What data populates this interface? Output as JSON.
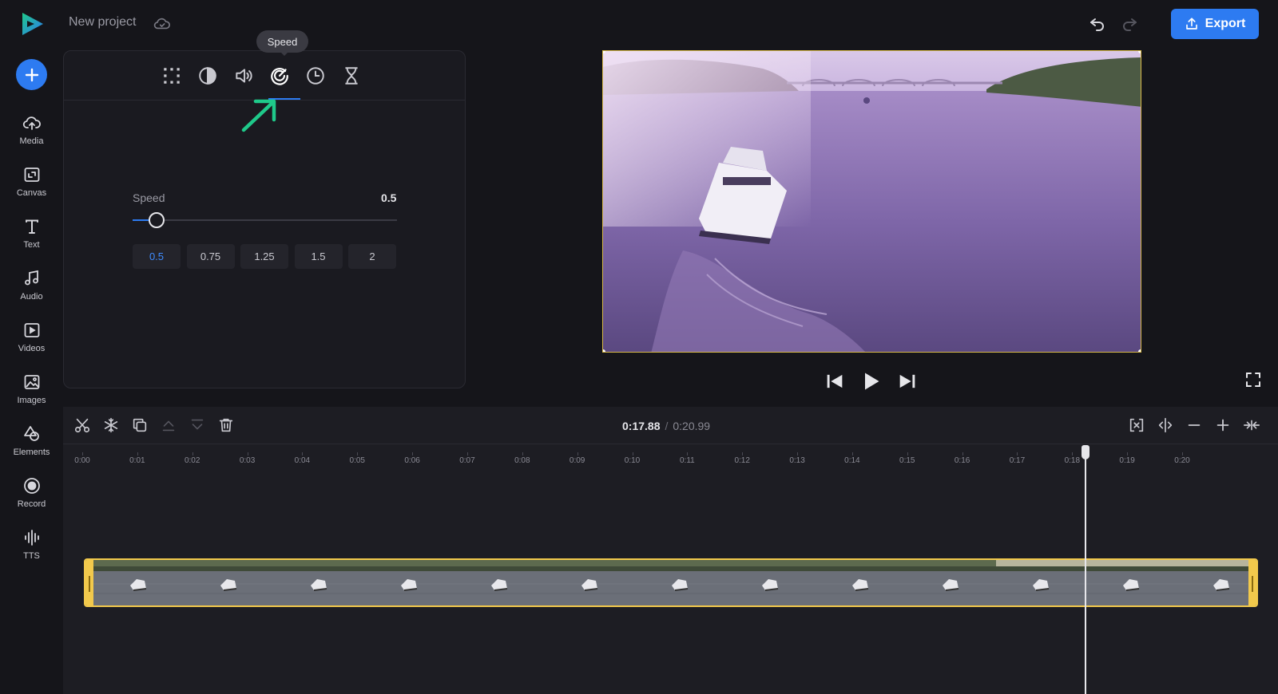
{
  "project": {
    "title": "New project"
  },
  "header": {
    "export_label": "Export"
  },
  "sidebar": {
    "items": [
      {
        "label": "Media",
        "icon": "cloud-upload-icon"
      },
      {
        "label": "Canvas",
        "icon": "canvas-icon"
      },
      {
        "label": "Text",
        "icon": "text-icon"
      },
      {
        "label": "Audio",
        "icon": "music-note-icon"
      },
      {
        "label": "Videos",
        "icon": "video-play-icon"
      },
      {
        "label": "Images",
        "icon": "image-icon"
      },
      {
        "label": "Elements",
        "icon": "shapes-icon"
      },
      {
        "label": "Record",
        "icon": "record-icon"
      },
      {
        "label": "TTS",
        "icon": "waveform-icon"
      }
    ]
  },
  "panel": {
    "tooltip": "Speed",
    "tabs": [
      "transform-icon",
      "filter-icon",
      "volume-icon",
      "speed-icon",
      "clock-icon",
      "hourglass-icon"
    ],
    "active_tab": "speed-icon",
    "speed": {
      "label": "Speed",
      "value": "0.5",
      "slider_fraction": 0.09,
      "presets": [
        "0.5",
        "0.75",
        "1.25",
        "1.5",
        "2"
      ],
      "active_preset": "0.5"
    }
  },
  "timeline": {
    "current_time": "0:17.88",
    "separator": "/",
    "total_time": "0:20.99",
    "ticks": [
      "0:00",
      "0:01",
      "0:02",
      "0:03",
      "0:04",
      "0:05",
      "0:06",
      "0:07",
      "0:08",
      "0:09",
      "0:10",
      "0:11",
      "0:12",
      "0:13",
      "0:14",
      "0:15",
      "0:16",
      "0:17",
      "0:18",
      "0:19",
      "0:20"
    ]
  },
  "colors": {
    "accent": "#2d7bf1",
    "clip_border": "#f2c94c",
    "annotation_arrow": "#1fc98a"
  }
}
